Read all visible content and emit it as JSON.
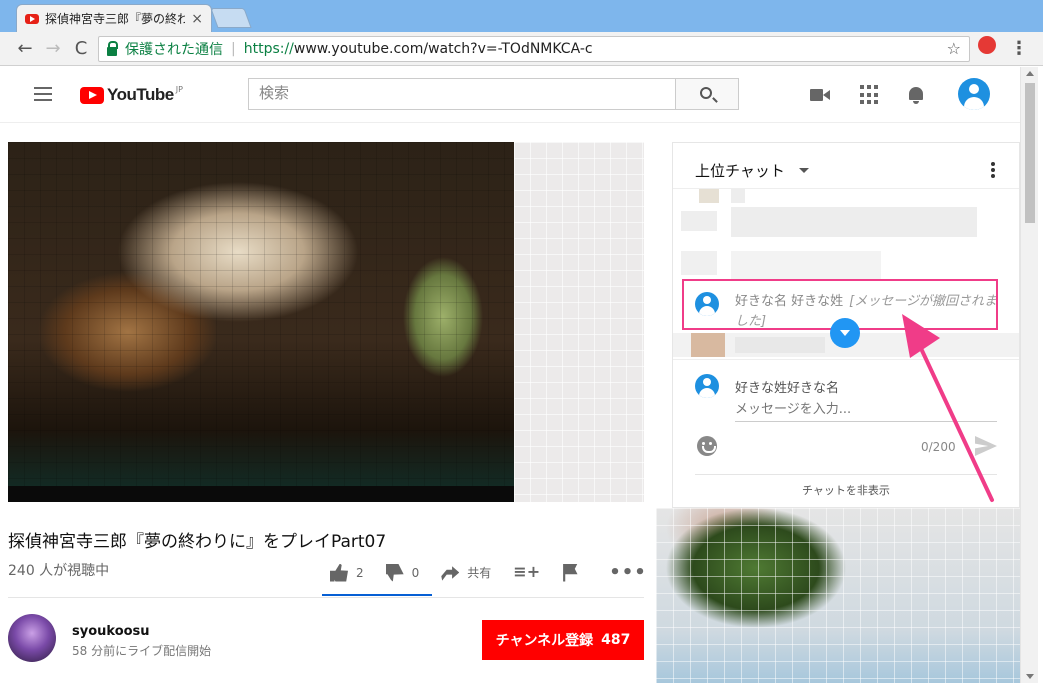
{
  "browser": {
    "tab_title": "探偵神宮寺三郎『夢の終わ",
    "tab_close": "×",
    "secure_label": "保護された通信",
    "url_proto": "https://",
    "url_rest": "www.youtube.com/watch?v=-TOdNMKCA-c",
    "back": "←",
    "forward": "→",
    "reload": "C",
    "star": "☆",
    "menu": "⋮"
  },
  "youtube": {
    "logo_text": "YouTube",
    "region": "JP",
    "search_placeholder": "検索"
  },
  "video": {
    "title": "探偵神宮寺三郎『夢の終わりに』をプレイPart07",
    "viewers": "240 人が視聴中",
    "like_count": "2",
    "dislike_count": "0",
    "share_label": "共有",
    "more": "•••"
  },
  "channel": {
    "name": "syoukoosu",
    "meta": "58 分前にライブ配信開始",
    "subscribe_label": "チャンネル登録",
    "subscribe_count": "487"
  },
  "chat": {
    "title": "上位チャット",
    "deleted_author": "好きな名 好きな姓",
    "deleted_message": "[メッセージが撤回されました]",
    "input_author": "好きな姓好きな名",
    "input_placeholder": "メッセージを入力...",
    "char_count": "0/200",
    "hide_label": "チャットを非表示"
  },
  "colors": {
    "accent_red": "#ff0000",
    "annotation_pink": "#f03c88",
    "secure_green": "#0b8043"
  }
}
